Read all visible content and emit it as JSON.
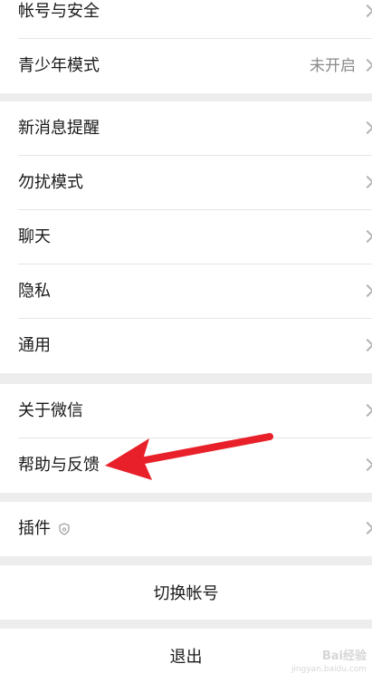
{
  "group1": {
    "account_security": "帐号与安全",
    "teen_mode": "青少年模式",
    "teen_mode_status": "未开启"
  },
  "group2": {
    "new_message_alert": "新消息提醒",
    "do_not_disturb": "勿扰模式",
    "chat": "聊天",
    "privacy": "隐私",
    "general": "通用"
  },
  "group3": {
    "about_wechat": "关于微信",
    "help_feedback": "帮助与反馈"
  },
  "group4": {
    "plugins": "插件"
  },
  "switch_account_label": "切换帐号",
  "logout_label": "退出",
  "watermark": {
    "brand": "Bai经验",
    "url": "jingyan.baidu.com"
  },
  "annotation": {
    "arrow_color": "#e8202a",
    "arrow_target": "help_feedback"
  },
  "colors": {
    "background": "#ededed",
    "card": "#ffffff",
    "secondary_text": "#8a8a8a"
  }
}
